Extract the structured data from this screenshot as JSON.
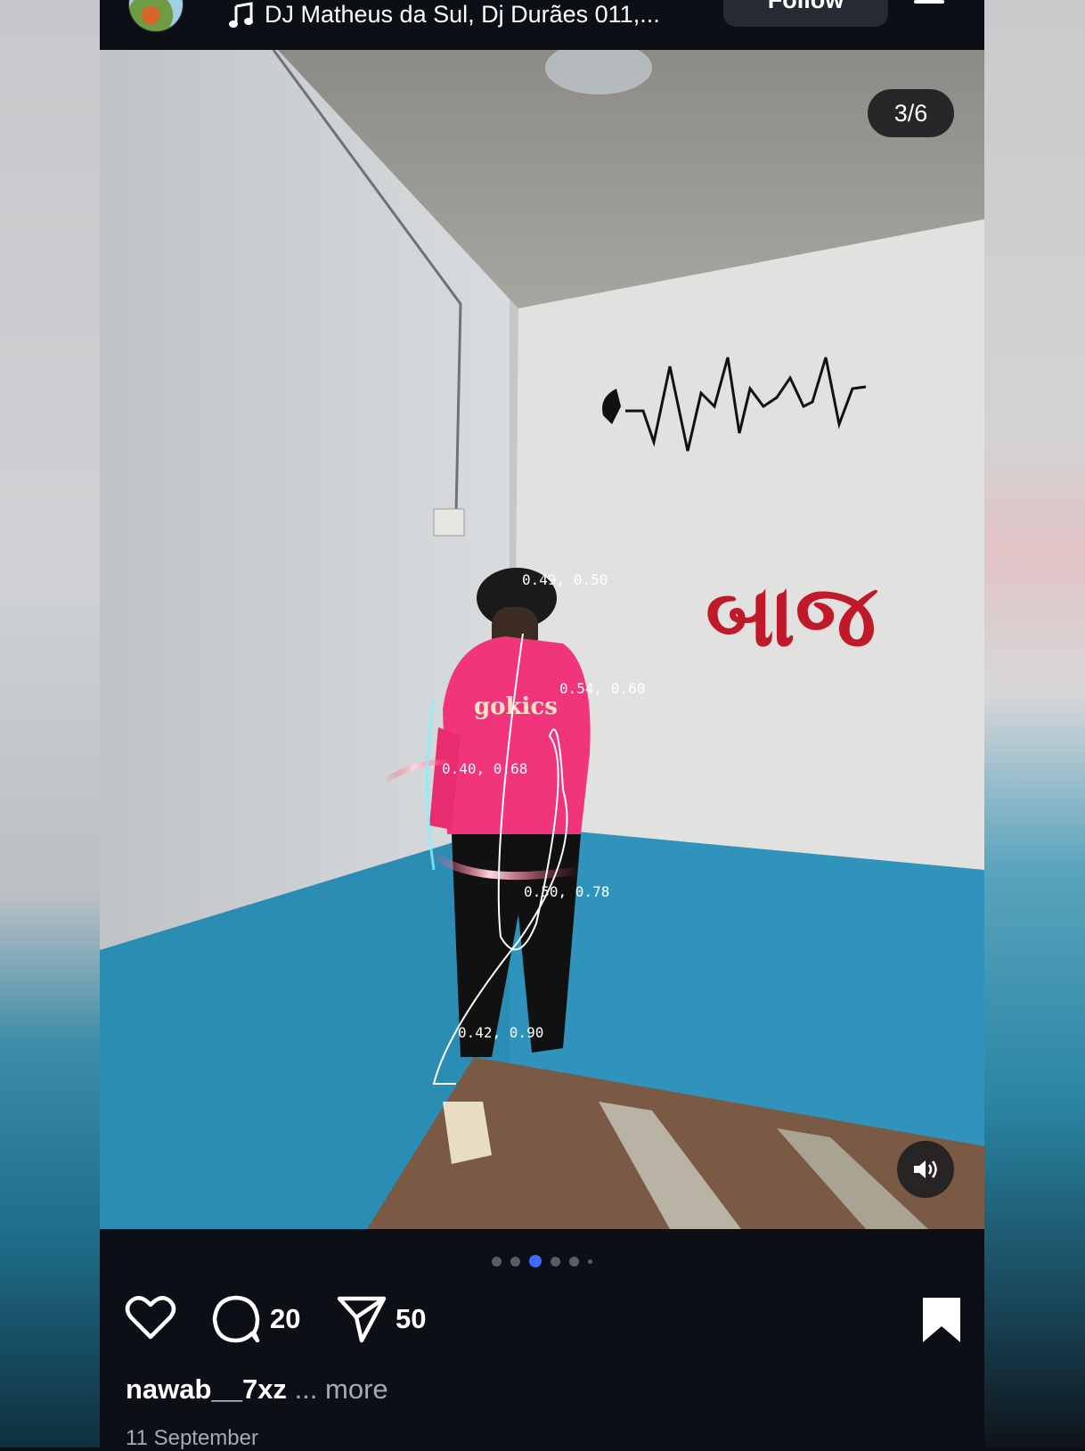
{
  "header": {
    "song": "DJ Matheus da Sul, Dj Durães 011,...",
    "follow_label": "Follow"
  },
  "media": {
    "counter": "3/6",
    "signage_text": "બાજ",
    "shirt_text": "gokics",
    "tracking_labels": [
      "0.49, 0.50",
      "0.54, 0.60",
      "0.40, 0.68",
      "0.50, 0.78",
      "0.42, 0.90"
    ],
    "active_slide": 3,
    "total_slides": 6
  },
  "actions": {
    "comments": "20",
    "shares": "50"
  },
  "caption": {
    "username": "nawab__7xz",
    "more": "... more"
  },
  "date": "11 September",
  "icons": [
    "music-icon",
    "menu-icon",
    "speaker-icon",
    "heart-icon",
    "comment-icon",
    "share-icon",
    "bookmark-icon"
  ],
  "colors": {
    "accent_dot": "#3d6bff",
    "shirt": "#f0357a",
    "wall_blue": "#2f93bb",
    "sign_red": "#c01a2a"
  }
}
